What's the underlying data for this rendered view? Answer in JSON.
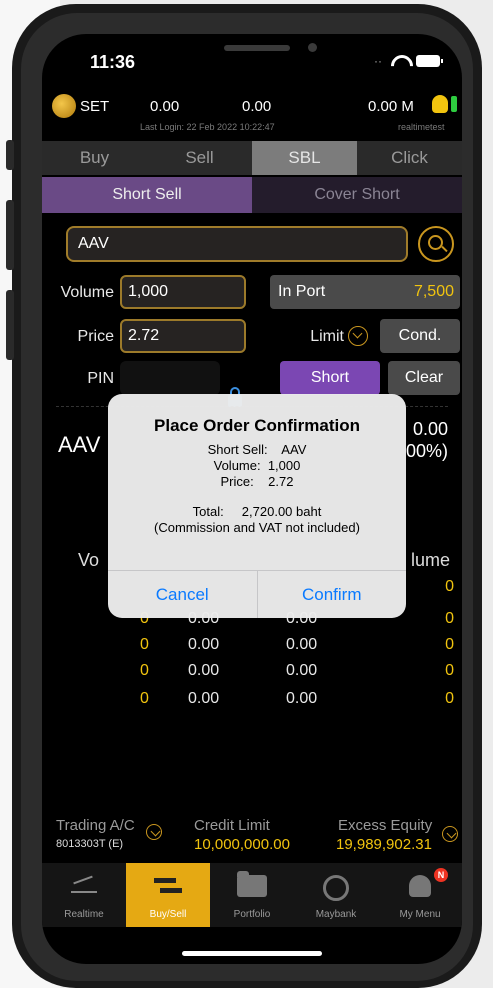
{
  "status": {
    "time": "11:36"
  },
  "header": {
    "market": "SET",
    "val1": "0.00",
    "val2": "0.00",
    "val3": "0.00 M",
    "last_login": "Last Login: 22 Feb 2022 10:22:47",
    "username": "realtimetest"
  },
  "tabs_primary": [
    "Buy",
    "Sell",
    "SBL",
    "Click"
  ],
  "tabs_secondary": [
    "Short Sell",
    "Cover Short"
  ],
  "form": {
    "symbol": "AAV",
    "volume_label": "Volume",
    "volume_value": "1,000",
    "in_port_label": "In Port",
    "in_port_value": "7,500",
    "price_label": "Price",
    "price_value": "2.72",
    "limit_label": "Limit",
    "cond_label": "Cond.",
    "pin_label": "PIN",
    "short_label": "Short",
    "clear_label": "Clear"
  },
  "quote": {
    "symbol": "AAV",
    "price": "0.00",
    "change": "00%)"
  },
  "book": {
    "vol_left": "Vo",
    "vol_right": "lume",
    "rows": [
      {
        "a": "",
        "b": "",
        "c": "",
        "d": "0"
      },
      {
        "a": "0",
        "b": "0.00",
        "c": "0.00",
        "d": "0"
      },
      {
        "a": "0",
        "b": "0.00",
        "c": "0.00",
        "d": "0"
      },
      {
        "a": "0",
        "b": "0.00",
        "c": "0.00",
        "d": "0"
      },
      {
        "a": "0",
        "b": "0.00",
        "c": "0.00",
        "d": "0"
      }
    ]
  },
  "account": {
    "trading_label": "Trading A/C",
    "trading_id": "8013303T (E)",
    "credit_label": "Credit Limit",
    "credit_value": "10,000,000.00",
    "excess_label": "Excess Equity",
    "excess_value": "19,989,902.31"
  },
  "nav": {
    "items": [
      "Realtime",
      "Buy/Sell",
      "Portfolio",
      "Maybank",
      "My Menu"
    ],
    "badge": "N",
    "active": "Buy/Sell"
  },
  "modal": {
    "title": "Place Order Confirmation",
    "short_sell": "Short Sell:    AAV",
    "volume": "Volume:  1,000",
    "price": "Price:    2.72",
    "total": "Total:     2,720.00 baht",
    "note": "(Commission and VAT not included)",
    "cancel": "Cancel",
    "confirm": "Confirm"
  },
  "colors": {
    "accent": "#e5a913",
    "purple": "#7b47b3",
    "ios_blue": "#0a7aff",
    "up_green": "#2ecc40"
  }
}
